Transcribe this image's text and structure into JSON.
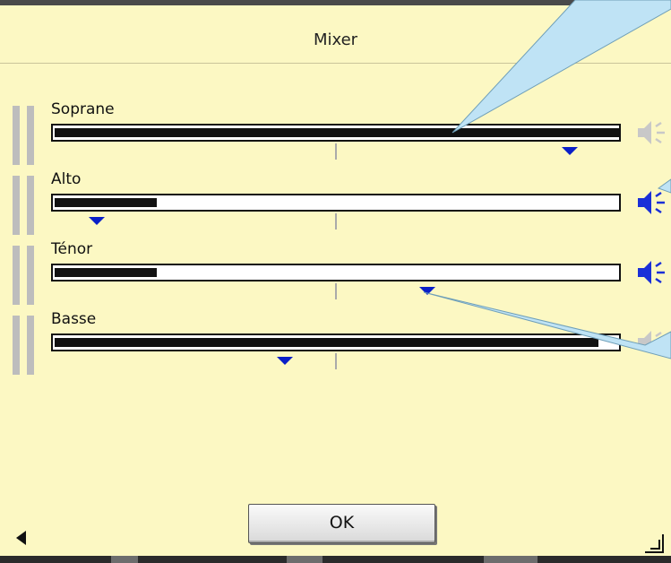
{
  "window": {
    "title": "Mixer"
  },
  "channels": [
    {
      "label": "Soprane",
      "level": 1.0,
      "pan": 0.91,
      "muted": true
    },
    {
      "label": "Alto",
      "level": 0.18,
      "pan": 0.08,
      "muted": false
    },
    {
      "label": "Ténor",
      "level": 0.18,
      "pan": 0.66,
      "muted": false
    },
    {
      "label": "Basse",
      "level": 0.96,
      "pan": 0.41,
      "muted": true
    }
  ],
  "buttons": {
    "ok": "OK"
  },
  "colors": {
    "panel": "#fcf8c3",
    "marker": "#0a1fc8",
    "speaker_active": "#1a2fd8",
    "speaker_muted": "#c8c8c8",
    "callout": "#bfe3f5"
  }
}
